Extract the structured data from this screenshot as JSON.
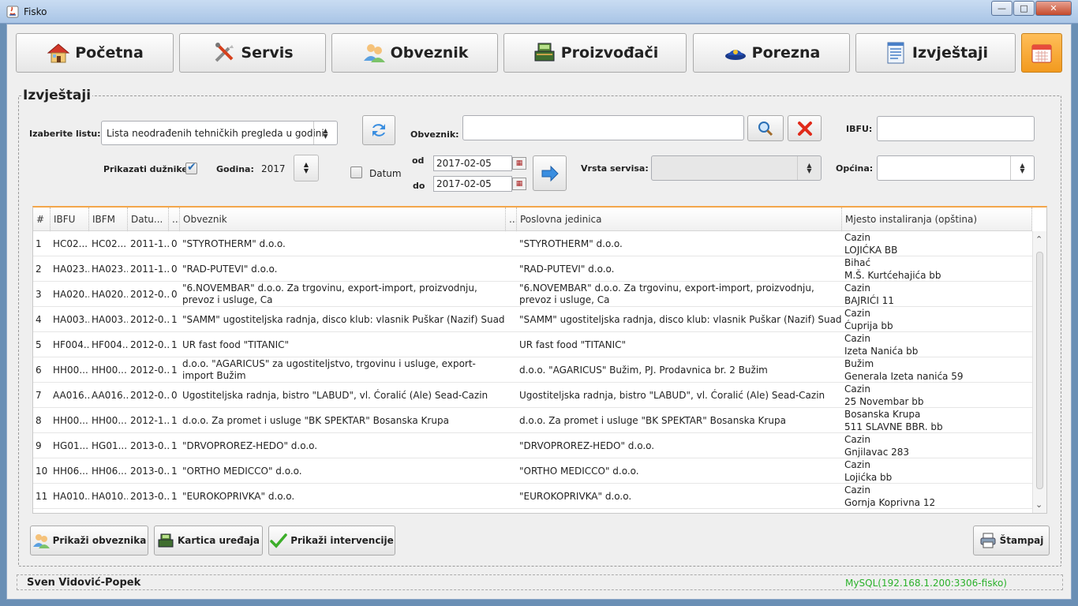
{
  "window": {
    "title": "Fisko",
    "minimize": "—",
    "maximize": "□",
    "close": "✕"
  },
  "nav": {
    "pocetna": "Početna",
    "servis": "Servis",
    "obveznik": "Obveznik",
    "proizvodaci": "Proizvođači",
    "porezna": "Porezna",
    "izvjestaji": "Izvještaji"
  },
  "panel": {
    "title": "Izvještaji"
  },
  "filters": {
    "izaberite_label": "Izaberite listu:",
    "list_value": "Lista neodrađenih tehničkih pregleda u godini",
    "obveznik_label": "Obveznik:",
    "obveznik_value": "",
    "ibfu_label": "IBFU:",
    "ibfu_value": "",
    "prikazati_label": "Prikazati dužnike:",
    "prikazati_checked": true,
    "godina_label": "Godina:",
    "godina_value": "2017",
    "datum_label": "Datum",
    "datum_checked": false,
    "od_label": "od",
    "od_value": "2017-02-05",
    "do_label": "do",
    "do_value": "2017-02-05",
    "vrsta_label": "Vrsta servisa:",
    "vrsta_value": "",
    "opcina_label": "Općina:",
    "opcina_value": ""
  },
  "table": {
    "headers": [
      "#",
      "IBFU",
      "IBFM",
      "Datu...",
      "...",
      "Obveznik",
      "...",
      "Poslovna jedinica",
      "Mjesto instaliranja (opština)"
    ],
    "rows": [
      {
        "n": "1",
        "ibfu": "HC02...",
        "ibfm": "HC02...",
        "datum": "2011-1...",
        "x": "0",
        "obveznik": "\"STYROTHERM\" d.o.o.",
        "pj": "\"STYROTHERM\" d.o.o.",
        "mjesto1": "Cazin",
        "mjesto2": "LOJIĆKA BB"
      },
      {
        "n": "2",
        "ibfu": "HA023...",
        "ibfm": "HA023...",
        "datum": "2011-1...",
        "x": "0",
        "obveznik": "\"RAD-PUTEVI\" d.o.o.",
        "pj": "\"RAD-PUTEVI\" d.o.o.",
        "mjesto1": "Bihać",
        "mjesto2": "M.Š. Kurtćehajića bb"
      },
      {
        "n": "3",
        "ibfu": "HA020...",
        "ibfm": "HA020...",
        "datum": "2012-0...",
        "x": "0",
        "obveznik": "\"6.NOVEMBAR\" d.o.o. Za trgovinu, export-import, proizvodnju, prevoz i usluge, Ca",
        "pj": "\"6.NOVEMBAR\" d.o.o. Za trgovinu, export-import, proizvodnju, prevoz i usluge, Ca",
        "mjesto1": "Cazin",
        "mjesto2": "BAJRIĆI 11"
      },
      {
        "n": "4",
        "ibfu": "HA003...",
        "ibfm": "HA003...",
        "datum": "2012-0...",
        "x": "1",
        "obveznik": "\"SAMM\" ugostiteljska radnja, disco klub: vlasnik Puškar (Nazif) Suad",
        "pj": "\"SAMM\" ugostiteljska radnja, disco klub: vlasnik Puškar (Nazif) Suad",
        "mjesto1": "Cazin",
        "mjesto2": "Ćuprija bb"
      },
      {
        "n": "5",
        "ibfu": "HF004...",
        "ibfm": "HF004...",
        "datum": "2012-0...",
        "x": "1",
        "obveznik": "UR fast food \"TITANIC\"",
        "pj": "UR fast food \"TITANIC\"",
        "mjesto1": "Cazin",
        "mjesto2": "Izeta Nanića bb"
      },
      {
        "n": "6",
        "ibfu": "HH00...",
        "ibfm": "HH00...",
        "datum": "2012-0...",
        "x": "1",
        "obveznik": "d.o.o. \"AGARICUS\" za ugostiteljstvo, trgovinu i usluge, export-import Bužim",
        "pj": "d.o.o. \"AGARICUS\" Bužim, PJ. Prodavnica br. 2 Bužim",
        "mjesto1": "Bužim",
        "mjesto2": "Generala Izeta nanića 59"
      },
      {
        "n": "7",
        "ibfu": "AA016...",
        "ibfm": "AA016...",
        "datum": "2012-0...",
        "x": "0",
        "obveznik": "Ugostiteljska radnja, bistro \"LABUD\", vl. Ćoralić (Ale) Sead-Cazin",
        "pj": "Ugostiteljska radnja, bistro \"LABUD\", vl. Ćoralić (Ale) Sead-Cazin",
        "mjesto1": "Cazin",
        "mjesto2": "25 Novembar bb"
      },
      {
        "n": "8",
        "ibfu": "HH00...",
        "ibfm": "HH00...",
        "datum": "2012-1...",
        "x": "1",
        "obveznik": "d.o.o. Za promet i usluge \"BK SPEKTAR\" Bosanska Krupa",
        "pj": "d.o.o. Za promet i usluge \"BK SPEKTAR\" Bosanska Krupa",
        "mjesto1": "Bosanska Krupa",
        "mjesto2": "511 SLAVNE BBR. bb"
      },
      {
        "n": "9",
        "ibfu": "HG01...",
        "ibfm": "HG01...",
        "datum": "2013-0...",
        "x": "1",
        "obveznik": "\"DRVOPROREZ-HEDO\" d.o.o.",
        "pj": "\"DRVOPROREZ-HEDO\" d.o.o.",
        "mjesto1": "Cazin",
        "mjesto2": "Gnjilavac 283"
      },
      {
        "n": "10",
        "ibfu": "HH06...",
        "ibfm": "HH06...",
        "datum": "2013-0...",
        "x": "1",
        "obveznik": "\"ORTHO MEDICCO\" d.o.o.",
        "pj": "\"ORTHO MEDICCO\" d.o.o.",
        "mjesto1": "Cazin",
        "mjesto2": "Lojićka bb"
      },
      {
        "n": "11",
        "ibfu": "HA010...",
        "ibfm": "HA010...",
        "datum": "2013-0...",
        "x": "1",
        "obveznik": "\"EUROKOPRIVKA\" d.o.o.",
        "pj": "\"EUROKOPRIVKA\" d.o.o.",
        "mjesto1": "Cazin",
        "mjesto2": "Gornja Koprivna 12"
      }
    ]
  },
  "actions": {
    "prikazi_obveznika": "Prikaži obveznika",
    "kartica_uredaja": "Kartica uređaja",
    "prikazi_intervencije": "Prikaži intervencije",
    "stampaj": "Štampaj"
  },
  "status": {
    "user": "Sven Vidović-Popek",
    "db": "MySQL(192.168.1.200:3306-fisko)"
  },
  "colors": {
    "accent": "#f3a64a",
    "db_status": "#2bb12b",
    "calendar_button": "#f29a1f"
  }
}
